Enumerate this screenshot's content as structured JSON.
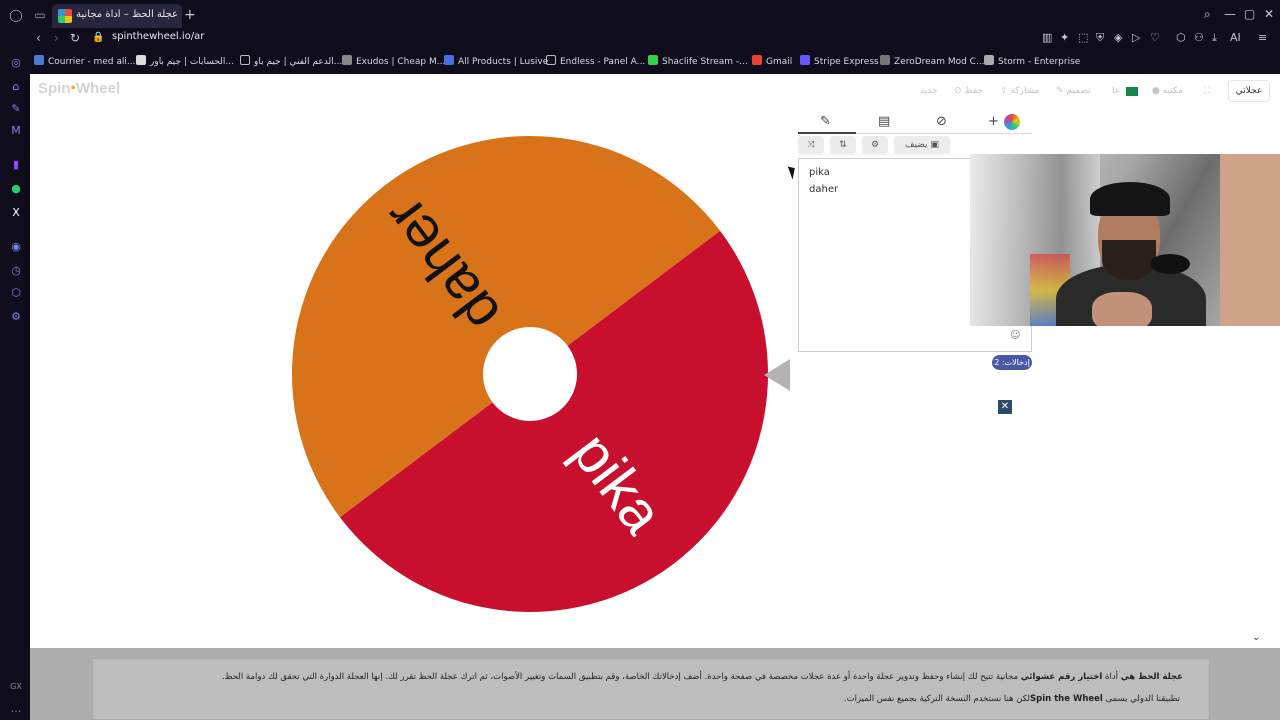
{
  "browser": {
    "tab_title": "عجلة الحظ – أداة مجانية لتدوير",
    "url": "spinthewheel.io/ar",
    "new_tab": "+",
    "bookmarks": [
      "Courrier - med ali...",
      "الحسابات | جيم باور...",
      "الدعم الفني | جيم باو...",
      "Exudos | Cheap M...",
      "All Products | Lusive",
      "Endless - Panel A...",
      "Shaclife Stream -...",
      "Gmail",
      "Stripe Express",
      "ZeroDream Mod C...",
      "Storm - Enterprise"
    ],
    "ai_label": "AI",
    "sidebar_bottom": "GX"
  },
  "site": {
    "logo": "Spin",
    "logo_b": "Wheel",
    "header": {
      "my_wheels": "عجلاتي",
      "library": "مكتبة",
      "lang": "عا",
      "customize": "تصميم",
      "share": "مشاركة",
      "save": "حفظ",
      "new": "جديد"
    },
    "wheel": {
      "entries": [
        "pika",
        "daher"
      ],
      "colors": [
        "#c8102e",
        "#d9731a"
      ]
    },
    "editor": {
      "add_image": "يضيف",
      "entries": [
        "pika",
        "daher"
      ],
      "entries_count": "إدخالات: 2",
      "emoji": "☺"
    },
    "footer": {
      "line1_bold1": "عجلة الحظ هي",
      "line1_mid": " أداة ",
      "line1_bold2": "اختيار رقم عشوائي",
      "line1_rest": " مجانية تتيح لك إنشاء وحفظ وتدوير عجلة واحدة أو عدة عجلات مخصصة في صفحة واحدة. أضف إدخالاتك الخاصة، وقم بتطبيق السمات وتغيير الأصوات، ثم اترك عجلة الحظ تقرر لك. إنها العجلة الدوارة التي تحقق لك دوامة الحظ.",
      "line2_a": "لكن هنا نستخدم النسخة التركية بجميع نفس الميزات. ",
      "line2_bold": "Spin the Wheel",
      "line2_b": " تطبيقنا الدولي يسمى"
    }
  }
}
